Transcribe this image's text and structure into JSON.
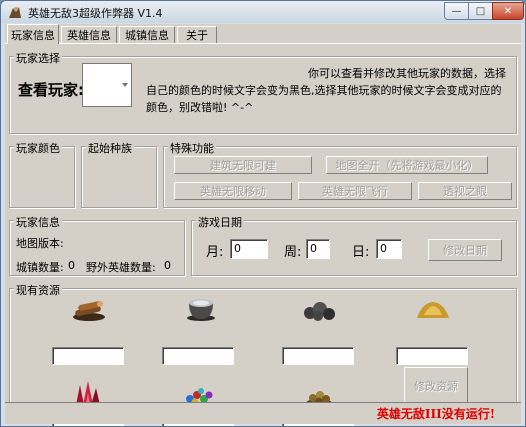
{
  "window": {
    "title": "英雄无敌3超级作弊器 V1.4",
    "min_glyph": "—",
    "max_glyph": "□",
    "close_glyph": "✕"
  },
  "tabs": [
    {
      "label": "玩家信息",
      "active": true
    },
    {
      "label": "英雄信息",
      "active": false
    },
    {
      "label": "城镇信息",
      "active": false
    },
    {
      "label": "关于",
      "active": false
    }
  ],
  "player_select": {
    "group_label": "玩家选择",
    "prompt": "查看玩家:",
    "selected_value": "",
    "hint_line1": "你可以查看并修改其他玩家的数据，选择",
    "hint_line2": "自己的颜色的时候文字会变为黑色,选择其他玩家的时候文字会变成对应的",
    "hint_line3": "颜色，别改错啦! ^-^"
  },
  "player_color": {
    "group_label": "玩家颜色"
  },
  "start_race": {
    "group_label": "起始种族"
  },
  "special": {
    "group_label": "特殊功能",
    "buttons": [
      "建筑无限可建",
      "地图全开（先将游戏最小化）",
      "英雄无限移动",
      "英雄无限飞行",
      "透视之眼"
    ]
  },
  "player_info": {
    "group_label": "玩家信息",
    "map_version_label": "地图版本:",
    "town_count_label": "城镇数量:",
    "town_count": "0",
    "wild_heroes_label": "野外英雄数量:",
    "wild_heroes": "0"
  },
  "game_date": {
    "group_label": "游戏日期",
    "month_label": "月:",
    "month": "0",
    "week_label": "周:",
    "week": "0",
    "day_label": "日:",
    "day": "0",
    "modify_button": "修改日期"
  },
  "resources": {
    "group_label": "现有资源",
    "items": [
      {
        "icon": "wood-icon",
        "value": ""
      },
      {
        "icon": "mercury-icon",
        "value": ""
      },
      {
        "icon": "ore-icon",
        "value": ""
      },
      {
        "icon": "sulfur-icon",
        "value": ""
      },
      {
        "icon": "crystal-icon",
        "value": ""
      },
      {
        "icon": "gems-icon",
        "value": ""
      },
      {
        "icon": "gold-icon",
        "value": ""
      }
    ],
    "modify_button": "修改资源"
  },
  "status": {
    "text": "英雄无敌III没有运行!",
    "color": "#e00000"
  }
}
